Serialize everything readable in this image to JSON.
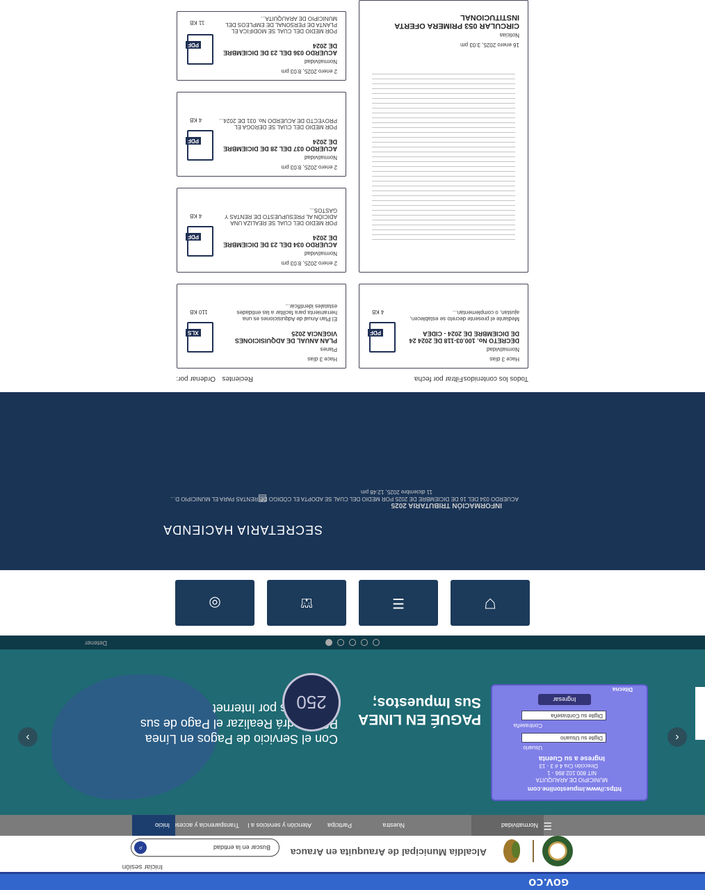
{
  "govbar": {
    "logo": "GOV.CO"
  },
  "header": {
    "title": "Alcaldía Municipal de Arauquita en Arauca",
    "login": "Iniciar sesión",
    "search_placeholder": "Buscar en la entidad"
  },
  "nav": {
    "items": [
      "Inicio",
      "Transparencia y acceso a la información pública",
      "Atención y servicios a la ciudadanía",
      "Participa",
      "Nuestra",
      "Normatividad"
    ]
  },
  "banner": {
    "title": "PAGUÉ EN LINEA Sus Impuestos;",
    "subtitle": "Con el Servicio de Pagos en Línea PSE Podrá Realizar el Pago de sus Impuestos por Internet",
    "emblem": "250",
    "card": {
      "url": "https://www.impuestonline.com",
      "municipio": "MUNICIPIO DE ARAUQUITA",
      "nit": "NIT 800.102.896 - 1",
      "dir": "Dirección Cra 4 # 3 - 13",
      "ingrese": "Ingrese a su Cuenta",
      "user_label": "Usuario",
      "user_field": "Digite su Usuario",
      "pass_label": "Contraseña",
      "pass_field": "Digite su Contraseña",
      "button": "Ingresar",
      "brand": "Ditecna"
    }
  },
  "controls": {
    "stop": "Detener"
  },
  "hacienda": {
    "title": "SECRETARIA HACIENDA",
    "news_title": "INFORMACIÓN TRIBUTARIA 2025",
    "news_desc": "ACUERDO 034 DEL 16 DE DICIEMBRE DE 2025 POR MEDIO DEL CUAL SE ADOPTA EL CÓDIGO DE RENTAS PARA EL MUNICIPIO D...",
    "news_date": "11 diciembre 2025, 12:48 pm"
  },
  "docs": {
    "order_label": "Ordenar por:",
    "order_value": "Recientes",
    "filter_label": "Filtrar por fecha",
    "filter_value": "Todos los contenidos",
    "cards": [
      {
        "date": "Hace 3 días",
        "cat": "Normatividad",
        "title": "DECRETO No. 100.03-118 DE 2024 24 DE DICIEMBRE DE 2024 - CIDEA",
        "desc": "Mediante el presente decreto se establecen, ajustan, o complementan...",
        "size": "4 KB",
        "tag": "PDF"
      },
      {
        "date": "Hace 3 días",
        "cat": "Planes",
        "title": "PLAN ANUAL DE ADQUISICIONES VIGENCIA 2025",
        "desc": "El Plan Anual de Adquisiciones es una herramienta para facilitar a las entidades estatales identificar...",
        "size": "110 KB",
        "tag": "XLS"
      },
      {
        "date": "2 enero 2025, 8:03 pm",
        "cat": "Normatividad",
        "title": "ACUERDO 034 DEL 23 DE DICIEMBRE DE 2024",
        "desc": "POR MEDIO DEL CUAL SE REALIZA UNA ADICIÓN AL PRESUPUESTO DE RENTAS Y GASTOS...",
        "size": "4 KB",
        "tag": "PDF"
      },
      {
        "date": "2 enero 2025, 8:03 pm",
        "cat": "Normatividad",
        "title": "ACUERDO 037 DEL 28 DE DICIEMBRE DE 2024",
        "desc": "POR MEDIO DEL CUAL SE DEROGA EL PROYECTO DE ACUERDO No. 031 DE 2024...",
        "size": "4 KB",
        "tag": "PDF"
      },
      {
        "date": "2 enero 2025, 8:03 pm",
        "cat": "Normatividad",
        "title": "ACUERDO 036 DEL 23 DE DICIEMBRE DE 2024",
        "desc": "POR MEDIO DEL CUAL SE MODIFICA EL PLANTA DE PERSONAL DE EMPLEOS DEL MUNICIPIO DE ARAUQUITA...",
        "size": "11 KB",
        "tag": "PDF"
      }
    ],
    "circular": {
      "date": "16 enero 2025, 3:03 pm",
      "cat": "Noticias",
      "title": "CIRCULAR 053 PRIMERA OFERTA INSTITUCIONAL"
    }
  }
}
